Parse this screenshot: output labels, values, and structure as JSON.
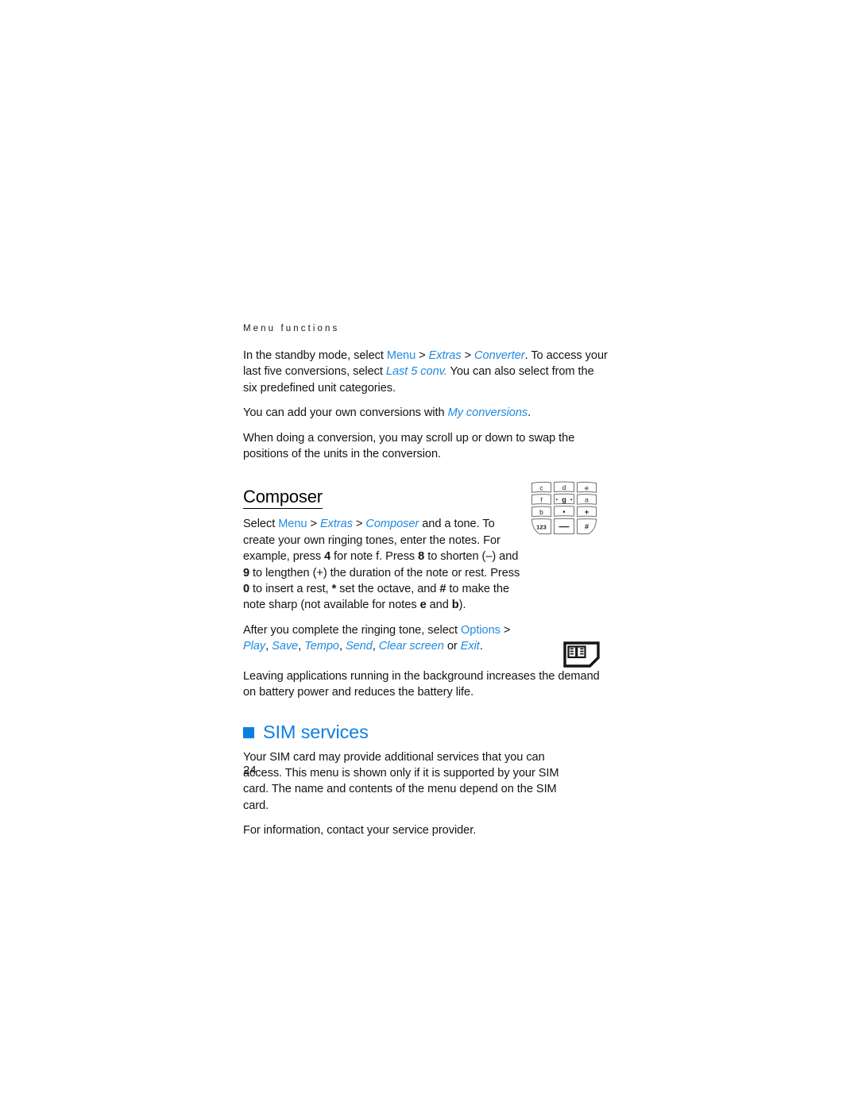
{
  "document": {
    "running_head": "Menu functions",
    "page_number": "24",
    "accent_blue": "#1f8ae0",
    "heading_blue": "#0c7fe4",
    "body_color": "#141414"
  },
  "converter_section": {
    "para1": {
      "t1": "In the standby mode, select ",
      "menu": "Menu",
      "sep1": " > ",
      "extras": "Extras",
      "sep2": " > ",
      "converter": "Converter",
      "t2": ". To access your last five conversions, select ",
      "last5": "Last 5 conv.",
      "t3": " You can also select from the six predefined unit categories."
    },
    "para2": {
      "t1": "You can add your own conversions with ",
      "myconv": "My conversions",
      "t2": "."
    },
    "para3": "When doing a conversion, you may scroll up or down to swap the positions of the units in the conversion."
  },
  "composer_section": {
    "heading": "Composer",
    "para1": {
      "t1": "Select ",
      "menu": "Menu",
      "sep1": " > ",
      "extras": "Extras",
      "sep2": " > ",
      "composer": "Composer",
      "t2": " and a tone. To create your own ringing tones, enter the notes. For example, press ",
      "k4": "4",
      "t3": " for note f. Press ",
      "k8": "8",
      "t4": " to shorten (–) and ",
      "k9": "9",
      "t5": " to lengthen (+) the duration of the note or rest. Press ",
      "k0": "0",
      "t6": " to insert a rest, ",
      "kstar": "*",
      "t7": " set the octave, and ",
      "khash": "#",
      "t8": " to make the note sharp (not available for notes ",
      "ke": "e",
      "t9": " and ",
      "kb": "b",
      "t10": ")."
    },
    "para2": {
      "t1": "After you complete the ringing tone, select ",
      "options": "Options",
      "sep": " > ",
      "play": "Play",
      "c1": ", ",
      "save": "Save",
      "c2": ", ",
      "tempo": "Tempo",
      "c3": ", ",
      "send": "Send",
      "c4": ", ",
      "clear_screen": "Clear screen",
      "or": " or ",
      "exit": "Exit",
      "end": "."
    },
    "para3": "Leaving applications running in the background increases the demand on battery power and reduces the battery life."
  },
  "keypad_graphic": {
    "rows": [
      [
        "c",
        "d",
        "e"
      ],
      [
        "f",
        "g",
        "a"
      ],
      [
        "b",
        "·",
        "+"
      ],
      [
        "123",
        "—",
        "#"
      ]
    ],
    "middle_key_dots": [
      "·",
      "·"
    ]
  },
  "sim_section": {
    "heading": "SIM services",
    "para1": "Your SIM card may provide additional services that you can access. This menu is shown only if it is supported by your SIM card. The name and contents of the menu depend on the SIM card.",
    "para2": "For information, contact your service provider."
  }
}
